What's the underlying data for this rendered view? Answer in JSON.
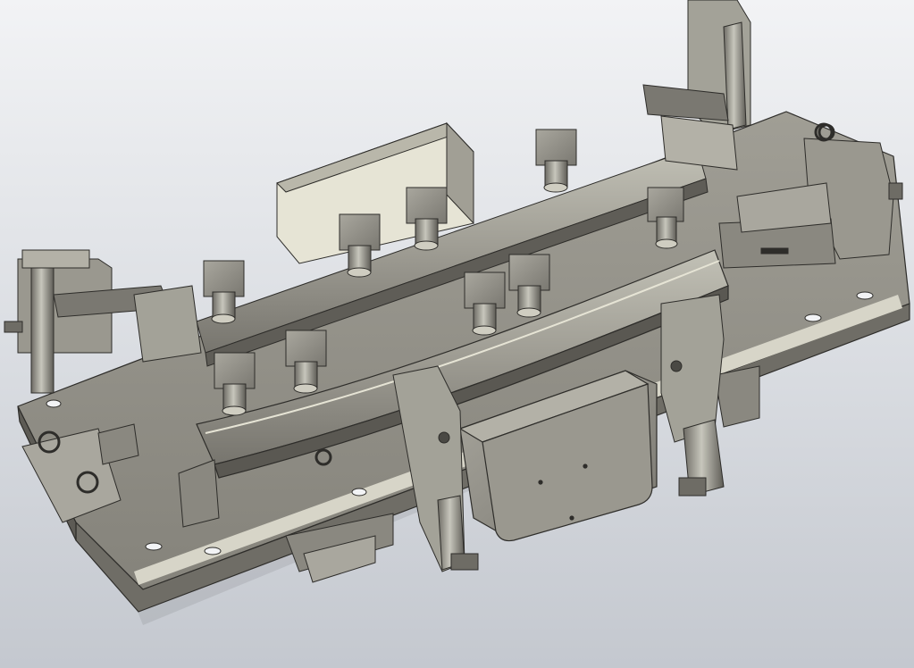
{
  "viewport": {
    "background_top": "#f2f3f5",
    "background_bottom": "#c4c8cf"
  },
  "model": {
    "base_plate_color": "#8f8d84",
    "base_plate_edge_color": "#4a4944",
    "part_color": "#a3a298",
    "dark_part_color": "#6e6c65",
    "highlight_color": "#e6e4d5",
    "edge_color": "#2e2d2a"
  }
}
